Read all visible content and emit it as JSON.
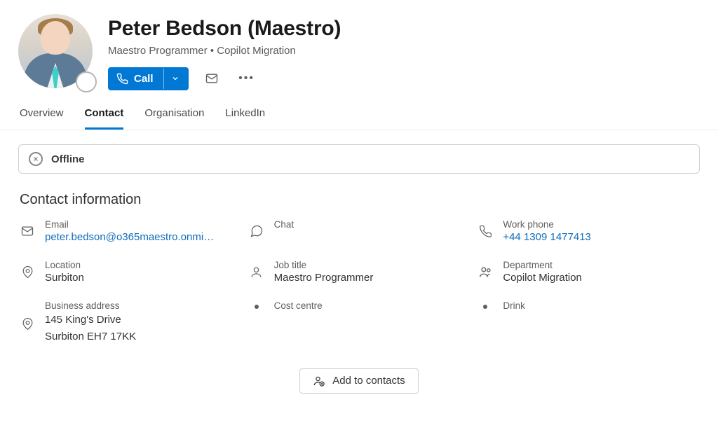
{
  "header": {
    "display_name": "Peter Bedson (Maestro)",
    "subtitle": "Maestro Programmer • Copilot Migration",
    "call_label": "Call"
  },
  "tabs": [
    {
      "label": "Overview",
      "active": false
    },
    {
      "label": "Contact",
      "active": true
    },
    {
      "label": "Organisation",
      "active": false
    },
    {
      "label": "LinkedIn",
      "active": false
    }
  ],
  "status": {
    "text": "Offline"
  },
  "section_title": "Contact information",
  "fields": {
    "email": {
      "label": "Email",
      "value": "peter.bedson@o365maestro.onmi…"
    },
    "chat": {
      "label": "Chat",
      "value": ""
    },
    "workphone": {
      "label": "Work phone",
      "value": "+44 1309 1477413"
    },
    "location": {
      "label": "Location",
      "value": "Surbiton"
    },
    "jobtitle": {
      "label": "Job title",
      "value": "Maestro Programmer"
    },
    "department": {
      "label": "Department",
      "value": "Copilot Migration"
    },
    "address": {
      "label": "Business address",
      "line1": "145 King's Drive",
      "line2": "Surbiton EH7 17KK"
    },
    "costcentre": {
      "label": "Cost centre"
    },
    "drink": {
      "label": "Drink"
    }
  },
  "add_contacts_label": "Add to contacts"
}
